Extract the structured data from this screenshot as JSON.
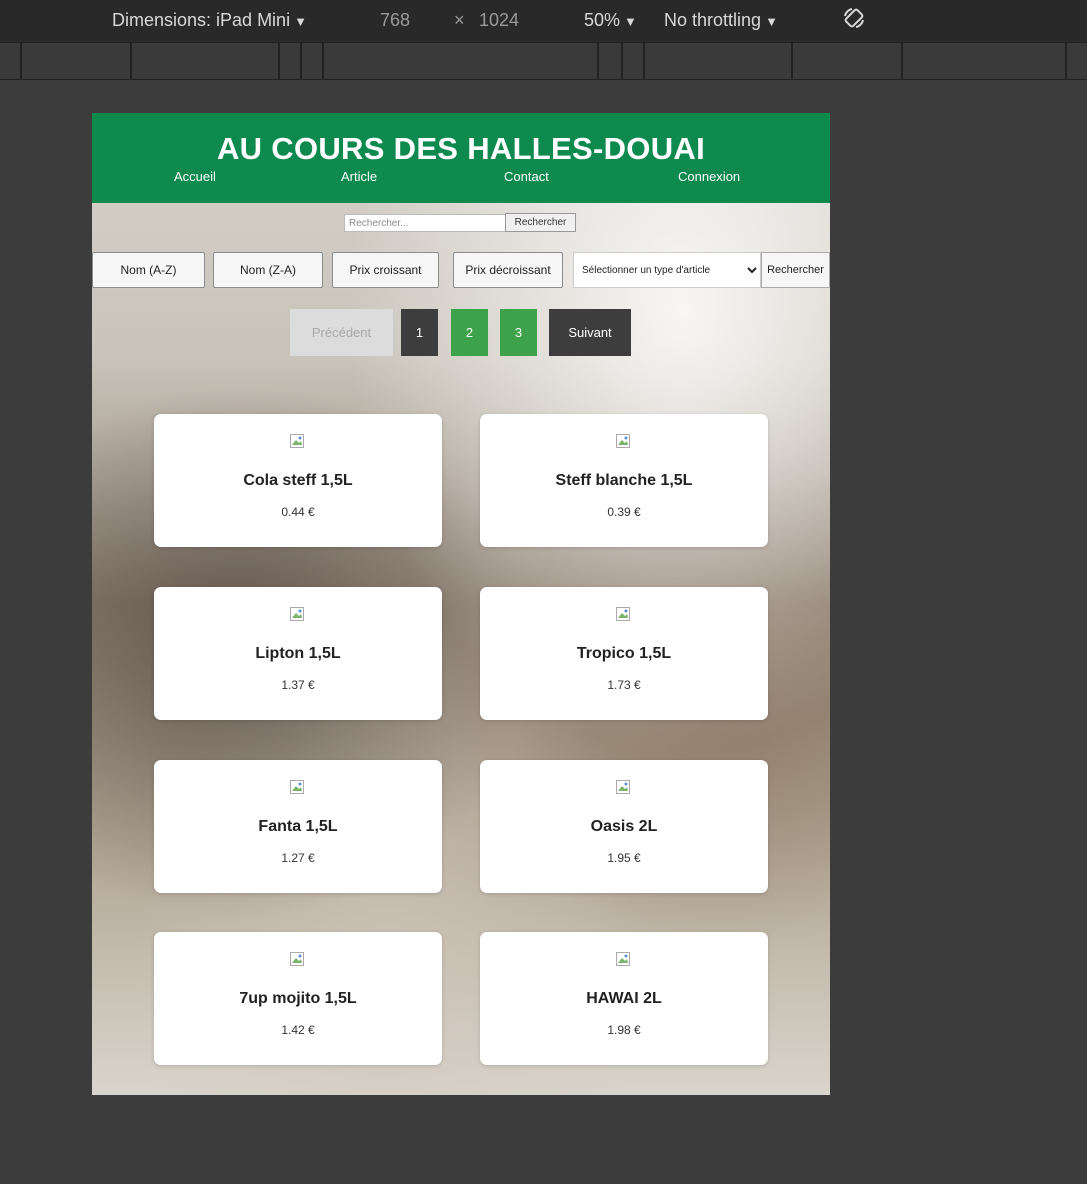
{
  "devtools": {
    "dimensions_label": "Dimensions: iPad Mini",
    "width": "768",
    "times": "×",
    "height": "1024",
    "zoom": "50%",
    "throttling": "No throttling",
    "caret": "▼"
  },
  "site": {
    "title": "AU COURS DES HALLES-DOUAI",
    "nav": [
      "Accueil",
      "Article",
      "Contact",
      "Connexion"
    ],
    "brand_color": "#0e8a4e"
  },
  "search": {
    "placeholder": "Rechercher...",
    "button": "Rechercher"
  },
  "sort": {
    "buttons": [
      "Nom (A-Z)",
      "Nom (Z-A)",
      "Prix croissant",
      "Prix décroissant"
    ],
    "type_select": "Sélectionner un type d'article",
    "type_button": "Rechercher"
  },
  "pagination": {
    "previous": "Précédent",
    "pages": [
      "1",
      "2",
      "3"
    ],
    "next": "Suivant",
    "current_page": "1"
  },
  "products": [
    {
      "name": "Cola steff 1,5L",
      "price": "0.44 €"
    },
    {
      "name": "Steff blanche 1,5L",
      "price": "0.39 €"
    },
    {
      "name": "Lipton 1,5L",
      "price": "1.37 €"
    },
    {
      "name": "Tropico 1,5L",
      "price": "1.73 €"
    },
    {
      "name": "Fanta 1,5L",
      "price": "1.27 €"
    },
    {
      "name": "Oasis 2L",
      "price": "1.95 €"
    },
    {
      "name": "7up mojito 1,5L",
      "price": "1.42 €"
    },
    {
      "name": "HAWAI 2L",
      "price": "1.98 €"
    }
  ]
}
